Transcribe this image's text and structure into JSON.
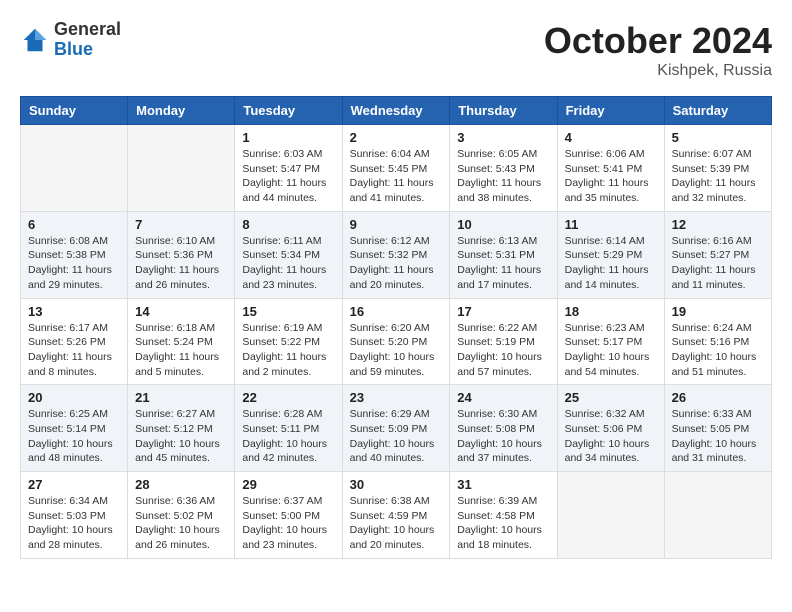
{
  "header": {
    "logo_general": "General",
    "logo_blue": "Blue",
    "title": "October 2024",
    "location": "Kishpek, Russia"
  },
  "weekdays": [
    "Sunday",
    "Monday",
    "Tuesday",
    "Wednesday",
    "Thursday",
    "Friday",
    "Saturday"
  ],
  "weeks": [
    [
      {
        "day": "",
        "detail": ""
      },
      {
        "day": "",
        "detail": ""
      },
      {
        "day": "1",
        "detail": "Sunrise: 6:03 AM\nSunset: 5:47 PM\nDaylight: 11 hours and 44 minutes."
      },
      {
        "day": "2",
        "detail": "Sunrise: 6:04 AM\nSunset: 5:45 PM\nDaylight: 11 hours and 41 minutes."
      },
      {
        "day": "3",
        "detail": "Sunrise: 6:05 AM\nSunset: 5:43 PM\nDaylight: 11 hours and 38 minutes."
      },
      {
        "day": "4",
        "detail": "Sunrise: 6:06 AM\nSunset: 5:41 PM\nDaylight: 11 hours and 35 minutes."
      },
      {
        "day": "5",
        "detail": "Sunrise: 6:07 AM\nSunset: 5:39 PM\nDaylight: 11 hours and 32 minutes."
      }
    ],
    [
      {
        "day": "6",
        "detail": "Sunrise: 6:08 AM\nSunset: 5:38 PM\nDaylight: 11 hours and 29 minutes."
      },
      {
        "day": "7",
        "detail": "Sunrise: 6:10 AM\nSunset: 5:36 PM\nDaylight: 11 hours and 26 minutes."
      },
      {
        "day": "8",
        "detail": "Sunrise: 6:11 AM\nSunset: 5:34 PM\nDaylight: 11 hours and 23 minutes."
      },
      {
        "day": "9",
        "detail": "Sunrise: 6:12 AM\nSunset: 5:32 PM\nDaylight: 11 hours and 20 minutes."
      },
      {
        "day": "10",
        "detail": "Sunrise: 6:13 AM\nSunset: 5:31 PM\nDaylight: 11 hours and 17 minutes."
      },
      {
        "day": "11",
        "detail": "Sunrise: 6:14 AM\nSunset: 5:29 PM\nDaylight: 11 hours and 14 minutes."
      },
      {
        "day": "12",
        "detail": "Sunrise: 6:16 AM\nSunset: 5:27 PM\nDaylight: 11 hours and 11 minutes."
      }
    ],
    [
      {
        "day": "13",
        "detail": "Sunrise: 6:17 AM\nSunset: 5:26 PM\nDaylight: 11 hours and 8 minutes."
      },
      {
        "day": "14",
        "detail": "Sunrise: 6:18 AM\nSunset: 5:24 PM\nDaylight: 11 hours and 5 minutes."
      },
      {
        "day": "15",
        "detail": "Sunrise: 6:19 AM\nSunset: 5:22 PM\nDaylight: 11 hours and 2 minutes."
      },
      {
        "day": "16",
        "detail": "Sunrise: 6:20 AM\nSunset: 5:20 PM\nDaylight: 10 hours and 59 minutes."
      },
      {
        "day": "17",
        "detail": "Sunrise: 6:22 AM\nSunset: 5:19 PM\nDaylight: 10 hours and 57 minutes."
      },
      {
        "day": "18",
        "detail": "Sunrise: 6:23 AM\nSunset: 5:17 PM\nDaylight: 10 hours and 54 minutes."
      },
      {
        "day": "19",
        "detail": "Sunrise: 6:24 AM\nSunset: 5:16 PM\nDaylight: 10 hours and 51 minutes."
      }
    ],
    [
      {
        "day": "20",
        "detail": "Sunrise: 6:25 AM\nSunset: 5:14 PM\nDaylight: 10 hours and 48 minutes."
      },
      {
        "day": "21",
        "detail": "Sunrise: 6:27 AM\nSunset: 5:12 PM\nDaylight: 10 hours and 45 minutes."
      },
      {
        "day": "22",
        "detail": "Sunrise: 6:28 AM\nSunset: 5:11 PM\nDaylight: 10 hours and 42 minutes."
      },
      {
        "day": "23",
        "detail": "Sunrise: 6:29 AM\nSunset: 5:09 PM\nDaylight: 10 hours and 40 minutes."
      },
      {
        "day": "24",
        "detail": "Sunrise: 6:30 AM\nSunset: 5:08 PM\nDaylight: 10 hours and 37 minutes."
      },
      {
        "day": "25",
        "detail": "Sunrise: 6:32 AM\nSunset: 5:06 PM\nDaylight: 10 hours and 34 minutes."
      },
      {
        "day": "26",
        "detail": "Sunrise: 6:33 AM\nSunset: 5:05 PM\nDaylight: 10 hours and 31 minutes."
      }
    ],
    [
      {
        "day": "27",
        "detail": "Sunrise: 6:34 AM\nSunset: 5:03 PM\nDaylight: 10 hours and 28 minutes."
      },
      {
        "day": "28",
        "detail": "Sunrise: 6:36 AM\nSunset: 5:02 PM\nDaylight: 10 hours and 26 minutes."
      },
      {
        "day": "29",
        "detail": "Sunrise: 6:37 AM\nSunset: 5:00 PM\nDaylight: 10 hours and 23 minutes."
      },
      {
        "day": "30",
        "detail": "Sunrise: 6:38 AM\nSunset: 4:59 PM\nDaylight: 10 hours and 20 minutes."
      },
      {
        "day": "31",
        "detail": "Sunrise: 6:39 AM\nSunset: 4:58 PM\nDaylight: 10 hours and 18 minutes."
      },
      {
        "day": "",
        "detail": ""
      },
      {
        "day": "",
        "detail": ""
      }
    ]
  ]
}
